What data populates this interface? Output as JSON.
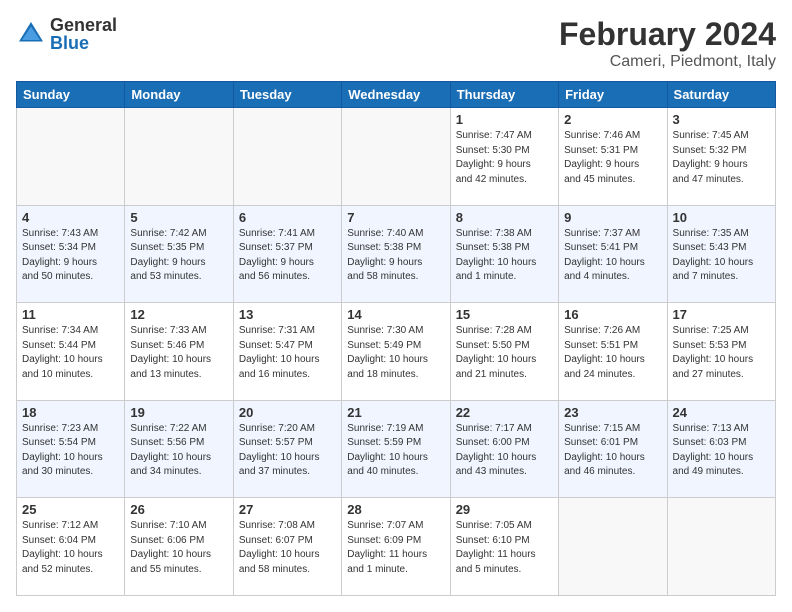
{
  "logo": {
    "general": "General",
    "blue": "Blue"
  },
  "title": "February 2024",
  "subtitle": "Cameri, Piedmont, Italy",
  "weekdays": [
    "Sunday",
    "Monday",
    "Tuesday",
    "Wednesday",
    "Thursday",
    "Friday",
    "Saturday"
  ],
  "weeks": [
    [
      {
        "day": "",
        "info": ""
      },
      {
        "day": "",
        "info": ""
      },
      {
        "day": "",
        "info": ""
      },
      {
        "day": "",
        "info": ""
      },
      {
        "day": "1",
        "info": "Sunrise: 7:47 AM\nSunset: 5:30 PM\nDaylight: 9 hours\nand 42 minutes."
      },
      {
        "day": "2",
        "info": "Sunrise: 7:46 AM\nSunset: 5:31 PM\nDaylight: 9 hours\nand 45 minutes."
      },
      {
        "day": "3",
        "info": "Sunrise: 7:45 AM\nSunset: 5:32 PM\nDaylight: 9 hours\nand 47 minutes."
      }
    ],
    [
      {
        "day": "4",
        "info": "Sunrise: 7:43 AM\nSunset: 5:34 PM\nDaylight: 9 hours\nand 50 minutes."
      },
      {
        "day": "5",
        "info": "Sunrise: 7:42 AM\nSunset: 5:35 PM\nDaylight: 9 hours\nand 53 minutes."
      },
      {
        "day": "6",
        "info": "Sunrise: 7:41 AM\nSunset: 5:37 PM\nDaylight: 9 hours\nand 56 minutes."
      },
      {
        "day": "7",
        "info": "Sunrise: 7:40 AM\nSunset: 5:38 PM\nDaylight: 9 hours\nand 58 minutes."
      },
      {
        "day": "8",
        "info": "Sunrise: 7:38 AM\nSunset: 5:38 PM\nDaylight: 10 hours\nand 1 minute."
      },
      {
        "day": "9",
        "info": "Sunrise: 7:37 AM\nSunset: 5:41 PM\nDaylight: 10 hours\nand 4 minutes."
      },
      {
        "day": "10",
        "info": "Sunrise: 7:35 AM\nSunset: 5:43 PM\nDaylight: 10 hours\nand 7 minutes."
      }
    ],
    [
      {
        "day": "11",
        "info": "Sunrise: 7:34 AM\nSunset: 5:44 PM\nDaylight: 10 hours\nand 10 minutes."
      },
      {
        "day": "12",
        "info": "Sunrise: 7:33 AM\nSunset: 5:46 PM\nDaylight: 10 hours\nand 13 minutes."
      },
      {
        "day": "13",
        "info": "Sunrise: 7:31 AM\nSunset: 5:47 PM\nDaylight: 10 hours\nand 16 minutes."
      },
      {
        "day": "14",
        "info": "Sunrise: 7:30 AM\nSunset: 5:49 PM\nDaylight: 10 hours\nand 18 minutes."
      },
      {
        "day": "15",
        "info": "Sunrise: 7:28 AM\nSunset: 5:50 PM\nDaylight: 10 hours\nand 21 minutes."
      },
      {
        "day": "16",
        "info": "Sunrise: 7:26 AM\nSunset: 5:51 PM\nDaylight: 10 hours\nand 24 minutes."
      },
      {
        "day": "17",
        "info": "Sunrise: 7:25 AM\nSunset: 5:53 PM\nDaylight: 10 hours\nand 27 minutes."
      }
    ],
    [
      {
        "day": "18",
        "info": "Sunrise: 7:23 AM\nSunset: 5:54 PM\nDaylight: 10 hours\nand 30 minutes."
      },
      {
        "day": "19",
        "info": "Sunrise: 7:22 AM\nSunset: 5:56 PM\nDaylight: 10 hours\nand 34 minutes."
      },
      {
        "day": "20",
        "info": "Sunrise: 7:20 AM\nSunset: 5:57 PM\nDaylight: 10 hours\nand 37 minutes."
      },
      {
        "day": "21",
        "info": "Sunrise: 7:19 AM\nSunset: 5:59 PM\nDaylight: 10 hours\nand 40 minutes."
      },
      {
        "day": "22",
        "info": "Sunrise: 7:17 AM\nSunset: 6:00 PM\nDaylight: 10 hours\nand 43 minutes."
      },
      {
        "day": "23",
        "info": "Sunrise: 7:15 AM\nSunset: 6:01 PM\nDaylight: 10 hours\nand 46 minutes."
      },
      {
        "day": "24",
        "info": "Sunrise: 7:13 AM\nSunset: 6:03 PM\nDaylight: 10 hours\nand 49 minutes."
      }
    ],
    [
      {
        "day": "25",
        "info": "Sunrise: 7:12 AM\nSunset: 6:04 PM\nDaylight: 10 hours\nand 52 minutes."
      },
      {
        "day": "26",
        "info": "Sunrise: 7:10 AM\nSunset: 6:06 PM\nDaylight: 10 hours\nand 55 minutes."
      },
      {
        "day": "27",
        "info": "Sunrise: 7:08 AM\nSunset: 6:07 PM\nDaylight: 10 hours\nand 58 minutes."
      },
      {
        "day": "28",
        "info": "Sunrise: 7:07 AM\nSunset: 6:09 PM\nDaylight: 11 hours\nand 1 minute."
      },
      {
        "day": "29",
        "info": "Sunrise: 7:05 AM\nSunset: 6:10 PM\nDaylight: 11 hours\nand 5 minutes."
      },
      {
        "day": "",
        "info": ""
      },
      {
        "day": "",
        "info": ""
      }
    ]
  ]
}
